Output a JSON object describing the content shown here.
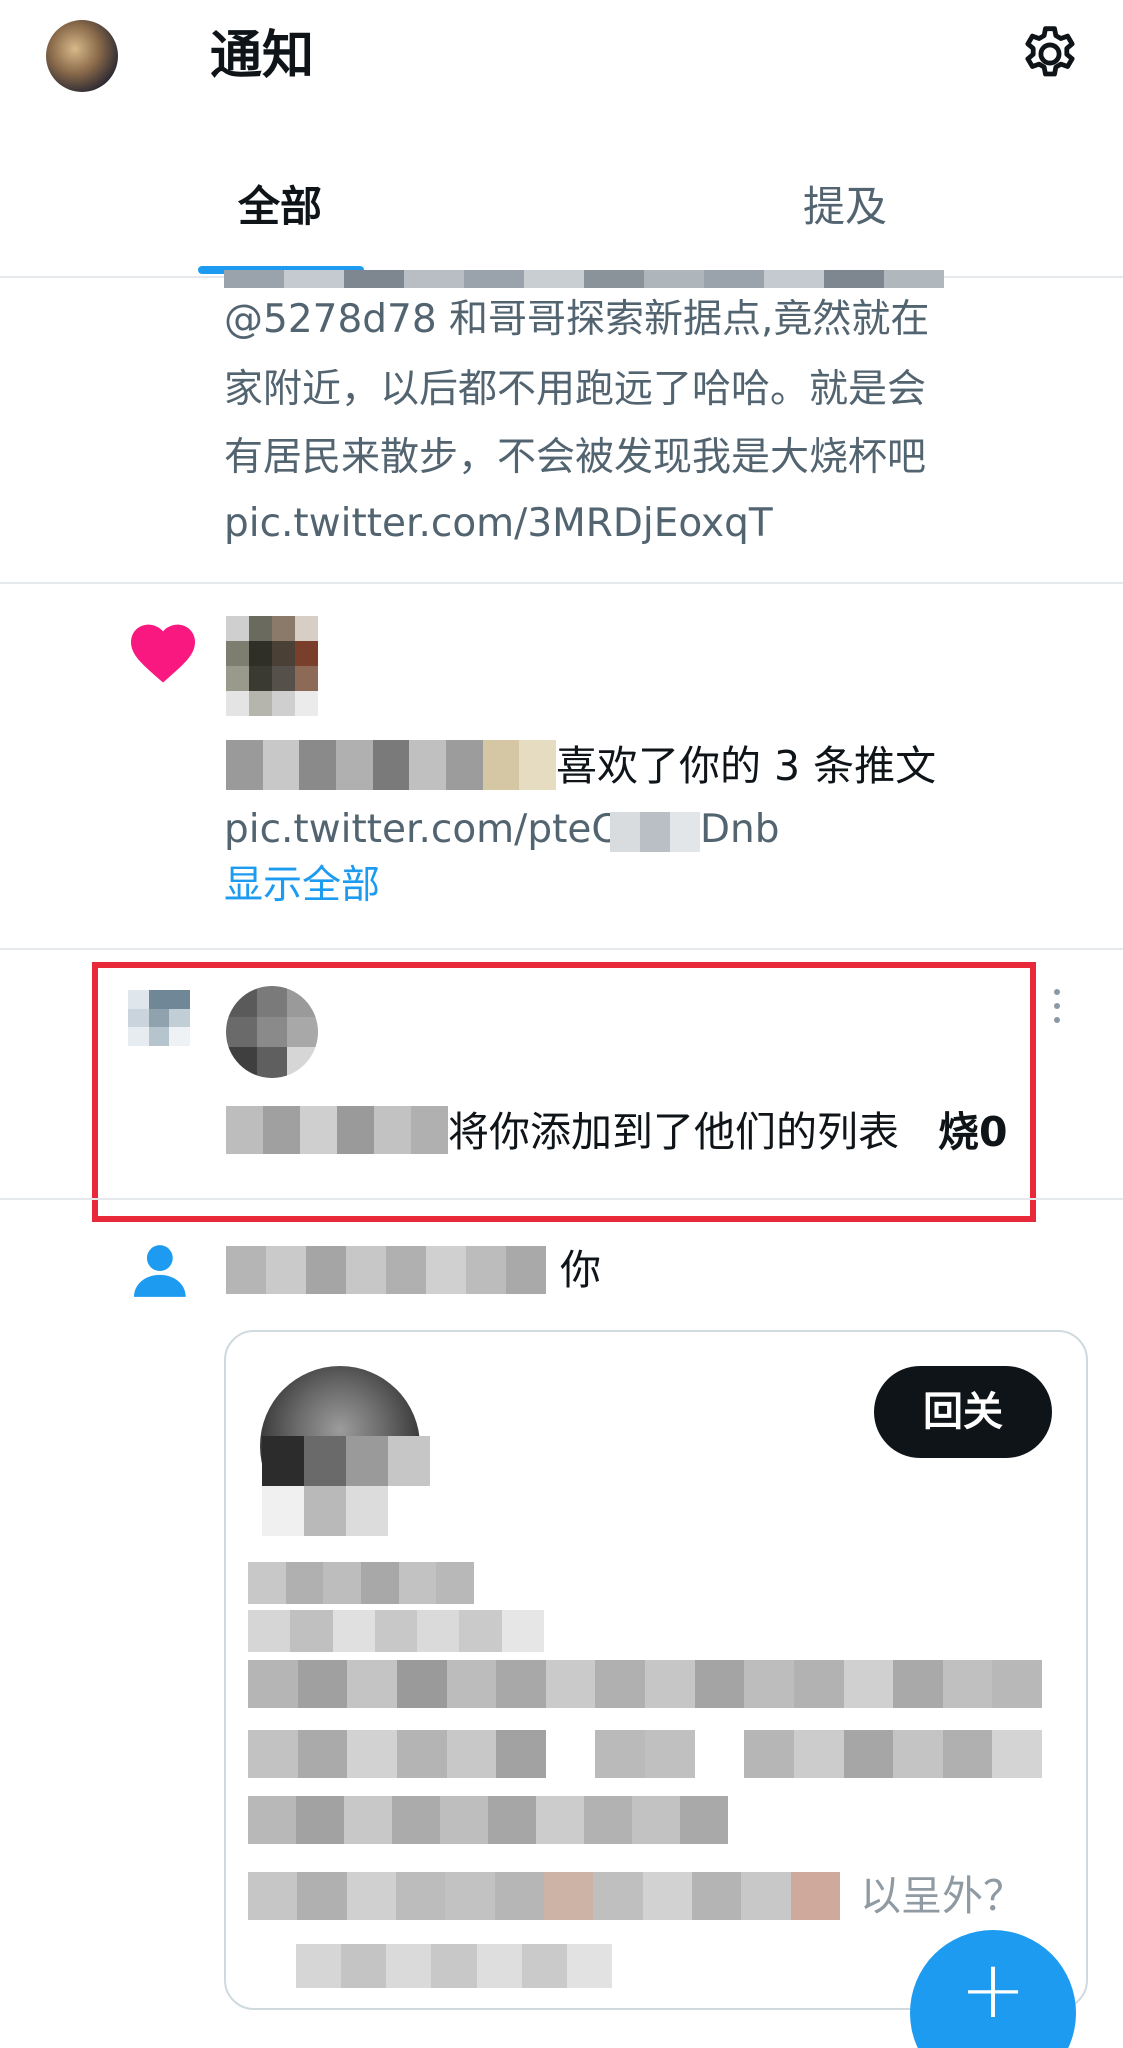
{
  "header": {
    "title": "通知",
    "settings_icon": "gear-icon",
    "avatar_icon": "avatar"
  },
  "tabs": [
    {
      "label": "全部",
      "active": true
    },
    {
      "label": "提及",
      "active": false
    }
  ],
  "colors": {
    "accent": "#1d9bf0",
    "text_primary": "#0f1419",
    "text_secondary": "#536471",
    "like": "#f91880",
    "highlight_border": "#e8293a"
  },
  "feed": {
    "tweet_preview": {
      "lines": [
        "@5278d78 和哥哥探索新据点,竟然就在",
        "家附近，以后都不用跑远了哈哈。就是会",
        "有居民来散步，不会被发现我是大烧杯吧",
        "pic.twitter.com/3MRDjEoxqT"
      ]
    },
    "like_notification": {
      "icon": "heart-icon",
      "text": "喜欢了你的 3 条推文",
      "link": "pic.twitter.com/pteC",
      "link_tail": "Dnb",
      "show_all": "显示全部"
    },
    "list_notification": {
      "icon": "list-icon",
      "text": "将你添加到了他们的列表",
      "list_name": "烧0",
      "more_icon": "more-vertical-icon"
    },
    "follow_notification": {
      "icon": "person-icon",
      "text_tail": "你",
      "follow_back_label": "回关",
      "bio_tail": "以呈外？"
    }
  },
  "fab": {
    "icon": "plus-icon",
    "label": "+"
  }
}
